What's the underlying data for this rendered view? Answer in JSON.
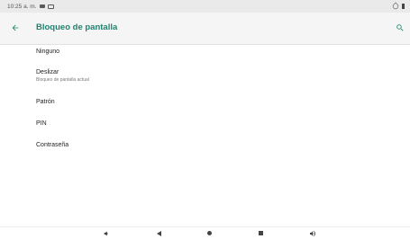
{
  "status_bar": {
    "time": "10:25 a. m."
  },
  "toolbar": {
    "title": "Bloqueo de pantalla"
  },
  "options": [
    {
      "title": "Ninguno",
      "subtitle": ""
    },
    {
      "title": "Deslizar",
      "subtitle": "Bloqueo de pantalla actual"
    },
    {
      "title": "Patrón",
      "subtitle": ""
    },
    {
      "title": "PIN",
      "subtitle": ""
    },
    {
      "title": "Contraseña",
      "subtitle": ""
    }
  ],
  "colors": {
    "accent": "#20836f",
    "status_bar_bg": "#eaeaea",
    "toolbar_bg": "#f5f5f5"
  },
  "icons": {
    "back": "arrow-left-icon",
    "search": "search-icon",
    "volume_down": "volume-down-icon",
    "back_nav": "nav-back-icon",
    "home": "nav-home-icon",
    "recents": "nav-recents-icon",
    "volume_up": "volume-up-icon"
  }
}
